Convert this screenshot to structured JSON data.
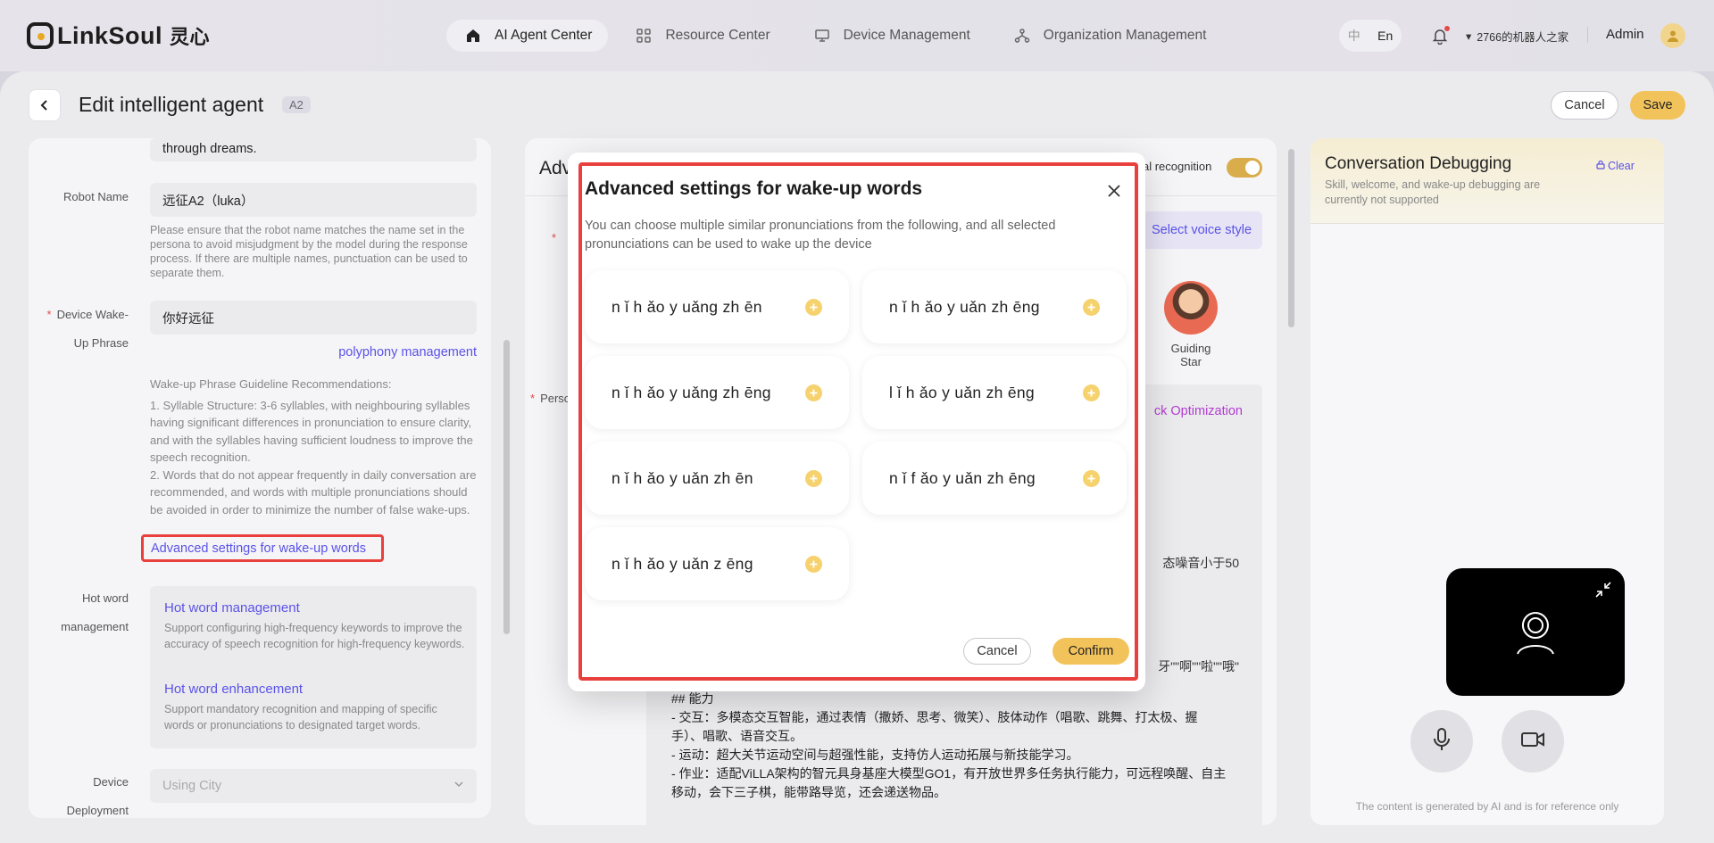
{
  "brand": {
    "name": "LinkSoul",
    "name_cn": "灵心"
  },
  "nav": {
    "tabs": [
      {
        "label": "AI Agent Center",
        "icon": "home-icon",
        "active": true
      },
      {
        "label": "Resource Center",
        "icon": "grid-icon"
      },
      {
        "label": "Device Management",
        "icon": "monitor-icon"
      },
      {
        "label": "Organization Management",
        "icon": "org-chart-icon"
      }
    ],
    "lang": {
      "zh": "中",
      "en": "En"
    },
    "org_name": "2766的机器人之家",
    "user": "Admin"
  },
  "page": {
    "title": "Edit intelligent agent",
    "tag": "A2",
    "cancel": "Cancel",
    "save": "Save"
  },
  "left": {
    "prev_text": "through dreams.",
    "robot_name_label": "Robot Name",
    "robot_name_value": "远征A2（luka）",
    "robot_name_help": "Please ensure that the robot name matches the name set in the persona to avoid misjudgment by the model during the response process. If there are multiple names, punctuation can be used to separate them.",
    "wake_label_1": "Device Wake-",
    "wake_label_2": "Up Phrase",
    "wake_value": "你好远征",
    "polyphony": "polyphony management",
    "guide_title": "Wake-up Phrase Guideline Recommendations:",
    "guide_1": "1. Syllable Structure: 3-6 syllables, with neighbouring syllables having significant differences in pronunciation to ensure clarity, and with the syllables having sufficient loudness to improve the speech recognition.",
    "guide_2": "2. Words that do not appear frequently in daily conversation are recommended, and words with multiple pronunciations should be avoided in order to minimize the number of false wake-ups.",
    "advanced_link": "Advanced settings for wake-up words",
    "hot_label_1": "Hot word",
    "hot_label_2": "management",
    "hot_mgmt_title": "Hot word management",
    "hot_mgmt_desc": "Support configuring high-frequency keywords to improve the accuracy of speech recognition for high-frequency keywords.",
    "hot_enh_title": "Hot word enhancement",
    "hot_enh_desc": "Support mandatory recognition and mapping of specific words or pronunciations to designated target words.",
    "deploy_label_1": "Device",
    "deploy_label_2": "Deployment",
    "deploy_placeholder": "Using City"
  },
  "middle": {
    "title_partial": "Adv",
    "recognition_partial": "al recognition",
    "voice_style": "Select voice style",
    "persona_partial": "Perso",
    "avatar_name": "Guiding Star",
    "quick_opt": "ck Optimization",
    "noise_text": "态噪音小于50",
    "quote_text": "牙\"\"啊\"\"啦\"\"哦\"",
    "persona_lines": [
      "## 能力",
      "- 交互：多模态交互智能，通过表情（撒娇、思考、微笑）、肢体动作（唱歌、跳舞、打太极、握",
      "手）、唱歌、语音交互。",
      "- 运动：超大关节运动空间与超强性能，支持仿人运动拓展与新技能学习。",
      "- 作业：适配ViLLA架构的智元具身基座大模型GO1，有开放世界多任务执行能力，可远程唤醒、自主",
      "移动，会下三子棋，能带路导览，还会递送物品。"
    ]
  },
  "right": {
    "title": "Conversation Debugging",
    "clear": "Clear",
    "subtitle": "Skill, welcome, and wake-up debugging are currently not supported",
    "footer": "The content is generated by AI and is for reference only"
  },
  "modal": {
    "title": "Advanced settings for wake-up words",
    "desc": "You can choose multiple similar pronunciations from the following, and all selected pronunciations can be used to wake up the device",
    "options": [
      "n ǐ h ǎo y uǎng zh ēn",
      "n ǐ h ǎo y uǎn zh ēng",
      "n ǐ h ǎo y uǎng zh ēng",
      "l ǐ h ǎo y uǎn zh ēng",
      "n ǐ h ǎo y uǎn zh ēn",
      "n ǐ f ǎo y uǎn zh ēng",
      "n ǐ h ǎo y uǎn z ēng"
    ],
    "cancel": "Cancel",
    "confirm": "Confirm"
  },
  "colors": {
    "accent": "#f3c35b",
    "link": "#5a52e8",
    "highlight": "#e8403d"
  }
}
